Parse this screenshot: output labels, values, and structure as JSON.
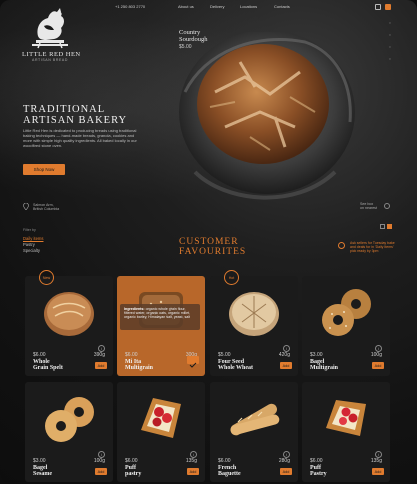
{
  "brand": {
    "name": "LITTLE RED HEN",
    "tagline": "ARTISAN BREAD"
  },
  "nav": {
    "phone": "+1 250 803 2770",
    "about": "About us",
    "delivery": "Delivery",
    "locations": "Locations",
    "contacts": "Contacts"
  },
  "hero": {
    "title_line1": "TRADITIONAL",
    "title_line2": "ARTISAN BAKERY",
    "description": "Little Red Hen is dedicated to producing breads using traditional baking techniques — hand-made breads, granola, cookies and more with simple high quality ingredients. All baked locally in our woodfired stone oven.",
    "shop_button": "Shop Now",
    "featured_name_line1": "Country",
    "featured_name_line2": "Sourdough",
    "featured_price": "$5.00",
    "address_line1": "Salmon Arm,",
    "address_line2": "British Columbia",
    "see_box_line1": "See box",
    "see_box_line2": "on nearest"
  },
  "filters": {
    "label": "Filter by",
    "items": [
      "Daily items",
      "Pastry",
      "Specialty"
    ]
  },
  "section": {
    "title_line1": "CUSTOMER",
    "title_line2": "FAVOURITES",
    "note": "Ask sellers for Tuesday bake and deals for in 'Daily Items' pick ready by 3pm"
  },
  "tooltip": {
    "label": "Ingredients:",
    "text": "organic whole grain flour, filtered water, organic oats, organic millet, organic barley, Himalayan salt, yeast, salt"
  },
  "products": [
    {
      "tag": "New",
      "price": "$6.00",
      "weight": "390g",
      "name_line1": "Whole",
      "name_line2": "Grain Spelt",
      "add": "Add"
    },
    {
      "tag": "",
      "price": "$6.00",
      "weight": "300g",
      "name_line1": "Mi Ita",
      "name_line2": "Multigrain",
      "add": ""
    },
    {
      "tag": "Hot",
      "price": "$5.00",
      "weight": "420g",
      "name_line1": "Four Seed",
      "name_line2": "Whole Wheat",
      "add": "Add"
    },
    {
      "tag": "",
      "price": "$3.00",
      "weight": "100g",
      "name_line1": "Bagel",
      "name_line2": "Multigrain",
      "add": "Add"
    },
    {
      "tag": "",
      "price": "$3.00",
      "weight": "100g",
      "name_line1": "Bagel",
      "name_line2": "Sesame",
      "add": "Add"
    },
    {
      "tag": "",
      "price": "$6.00",
      "weight": "135g",
      "name_line1": "Puff",
      "name_line2": "pastry",
      "add": "Add"
    },
    {
      "tag": "",
      "price": "$6.00",
      "weight": "280g",
      "name_line1": "French",
      "name_line2": "Baguette",
      "add": "Add"
    },
    {
      "tag": "",
      "price": "$6.00",
      "weight": "135g",
      "name_line1": "Puff",
      "name_line2": "Pastry",
      "add": "Add"
    }
  ],
  "colors": {
    "accent": "#e07b2e",
    "background": "#121212",
    "card": "#1b1b1b",
    "card_highlight": "#b8672a"
  }
}
